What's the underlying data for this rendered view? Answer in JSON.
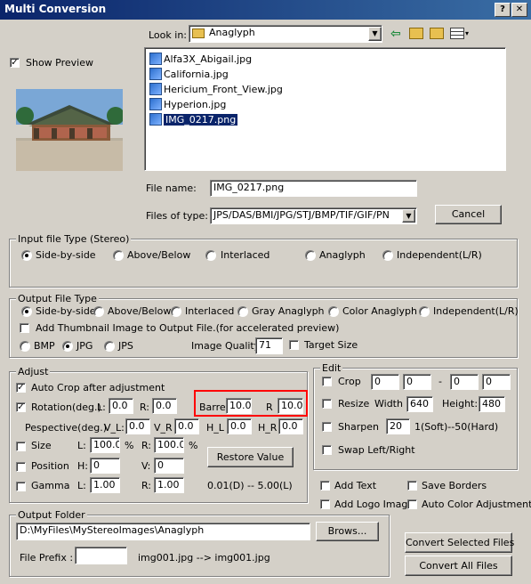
{
  "window": {
    "title": "Multi Conversion",
    "help_btn": "?",
    "close_btn": "✕"
  },
  "preview": {
    "show_preview_label": "Show Preview",
    "show_preview_checked": true
  },
  "lookin": {
    "label": "Look in:",
    "value": "Anaglyph"
  },
  "files": [
    "Alfa3X_Abigail.jpg",
    "California.jpg",
    "Hericium_Front_View.jpg",
    "Hyperion.jpg",
    "IMG_0217.png"
  ],
  "selected_file_index": 4,
  "filename": {
    "label": "File name:",
    "value": "IMG_0217.png"
  },
  "filetype": {
    "label": "Files of type:",
    "value": "JPS/DAS/BMI/JPG/STJ/BMP/TIF/GIF/PN"
  },
  "cancel_label": "Cancel",
  "input_type": {
    "title": "Input file Type (Stereo)",
    "options": [
      "Side-by-side",
      "Above/Below",
      "Interlaced",
      "Anaglyph",
      "Independent(L/R)"
    ],
    "selected": 0
  },
  "output_type": {
    "title": "Output File Type",
    "options": [
      "Side-by-side",
      "Above/Below",
      "Interlaced",
      "Gray Anaglyph",
      "Color Anaglyph",
      "Independent(L/R)"
    ],
    "selected": 0,
    "thumbnail_label": "Add Thumbnail Image to Output File.(for accelerated preview)",
    "formats": [
      "BMP",
      "JPG",
      "JPS"
    ],
    "format_selected": 1,
    "quality_label": "Image Quality:",
    "quality_value": "71",
    "target_size_label": "Target Size"
  },
  "adjust": {
    "title": "Adjust",
    "autocrop_label": "Auto Crop after adjustment",
    "rotation_label": "Rotation(deg.)",
    "rot_l_label": "L:",
    "rot_l": "0.0",
    "rot_r_label": "R:",
    "rot_r": "0.0",
    "barrel_label": "Barrel",
    "barrel": "10.0",
    "barrel_r_label": "R",
    "barrel_r": "10.0",
    "perspective_label": "Pespective(deg.)",
    "vl_label": "V_L:",
    "vl": "0.0",
    "vr_label": "V_R",
    "vr": "0.0",
    "hl_label": "H_L",
    "hl": "0.0",
    "hr_label": "H_R",
    "hr": "0.0",
    "size_label": "Size",
    "size_l_label": "L:",
    "size_l": "100.0",
    "size_r_label": "R:",
    "size_r": "100.0",
    "percent": "%",
    "position_label": "Position",
    "pos_h_label": "H:",
    "pos_h": "0",
    "pos_v_label": "V:",
    "pos_v": "0",
    "gamma_label": "Gamma",
    "gamma_l_label": "L:",
    "gamma_l": "1.00",
    "gamma_r_label": "R:",
    "gamma_r": "1.00",
    "restore_label": "Restore Value",
    "gamma_range": "0.01(D) -- 5.00(L)"
  },
  "edit": {
    "title": "Edit",
    "crop_label": "Crop",
    "crop_1": "0",
    "crop_2": "0",
    "crop_dash": "-",
    "crop_3": "0",
    "crop_4": "0",
    "resize_label": "Resize",
    "width_label": "Width",
    "width": "640",
    "height_label": "Height:",
    "height": "480",
    "sharpen_label": "Sharpen",
    "sharpen": "20",
    "sharpen_range": "1(Soft)--50(Hard)",
    "swap_label": "Swap Left/Right"
  },
  "extras": {
    "add_text": "Add Text",
    "save_borders": "Save Borders",
    "add_logo": "Add Logo Image",
    "auto_color": "Auto Color Adjustment"
  },
  "output_folder": {
    "title": "Output Folder",
    "path": "D:\\MyFiles\\MyStereoImages\\Anaglyph",
    "browse_label": "Brows...",
    "prefix_label": "File Prefix :",
    "prefix_value": "",
    "example": "img001.jpg --> img001.jpg"
  },
  "actions": {
    "convert_selected": "Convert Selected Files",
    "convert_all": "Convert All Files"
  },
  "colors": {
    "titlebar": "#0a246a",
    "highlight": "#ff0000",
    "face": "#d4d0c8"
  }
}
